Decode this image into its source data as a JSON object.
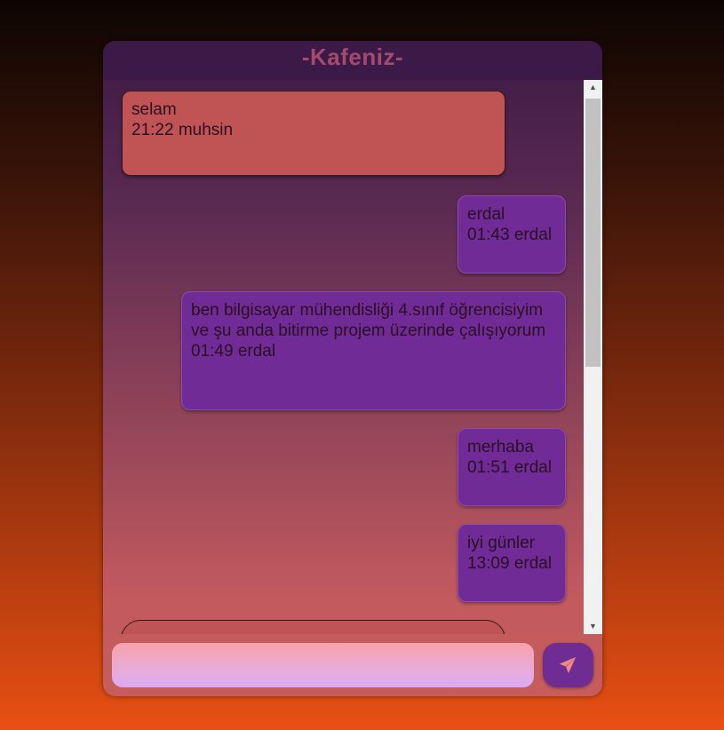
{
  "app": {
    "title": "-Kafeniz-"
  },
  "messages": [
    {
      "side": "left",
      "text": "selam",
      "time": "21:22",
      "user": "muhsin",
      "meta": "21:22 muhsin"
    },
    {
      "side": "right",
      "text": "erdal",
      "time": "01:43",
      "user": "erdal",
      "meta": "01:43 erdal"
    },
    {
      "side": "right",
      "text": "ben bilgisayar mühendisliği 4.sınıf öğrencisiyim ve şu anda bitirme projem üzerinde çalışıyorum",
      "time": "01:49",
      "user": "erdal",
      "meta": "01:49 erdal"
    },
    {
      "side": "right",
      "text": "merhaba",
      "time": "01:51",
      "user": "erdal",
      "meta": "01:51 erdal"
    },
    {
      "side": "right",
      "text": "iyi günler",
      "time": "13:09",
      "user": "erdal",
      "meta": "13:09 erdal"
    },
    {
      "side": "left",
      "text": "",
      "meta": ""
    }
  ],
  "composer": {
    "value": "",
    "placeholder": ""
  },
  "icons": {
    "send": "paper-plane-icon",
    "scroll_up": "scroll-up-arrow-icon",
    "scroll_down": "scroll-down-arrow-icon"
  },
  "colors": {
    "left_bubble": "#c05454",
    "right_bubble": "#702b96",
    "title": "#a34a6e",
    "send_icon": "#f08a8a"
  }
}
